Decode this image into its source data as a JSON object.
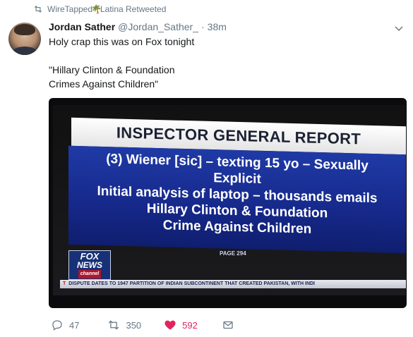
{
  "context": {
    "retweeted_by_prefix": "WireTapped",
    "retweeted_by_emoji": "🌴",
    "retweeted_by_suffix": "Latina Retweeted"
  },
  "author": {
    "display_name": "Jordan Sather",
    "handle": "@Jordan_Sather_",
    "separator": "·",
    "time": "38m"
  },
  "tweet": {
    "line1": "Holy crap this was on Fox tonight",
    "line2": "\"Hillary Clinton & Foundation",
    "line3": "Crimes Against Children\""
  },
  "media": {
    "title": "INSPECTOR GENERAL REPORT",
    "body_lines": [
      "(3) Wiener [sic] – texting 15 yo – Sexually",
      "Explicit",
      "Initial analysis of laptop – thousands emails",
      "Hillary Clinton & Foundation",
      "Crime Against Children"
    ],
    "page_label": "PAGE 294",
    "logo_line1": "FOX",
    "logo_line2": "NEWS",
    "logo_line3": "channel",
    "ticker_lead": "T",
    "ticker_text": "DISPUTE DATES TO 1947 PARTITION OF INDIAN SUBCONTINENT THAT CREATED PAKISTAN, WITH INDI"
  },
  "actions": {
    "replies": "47",
    "retweets": "350",
    "likes": "592"
  },
  "colors": {
    "like_accent": "#e0245e",
    "muted": "#657786"
  }
}
